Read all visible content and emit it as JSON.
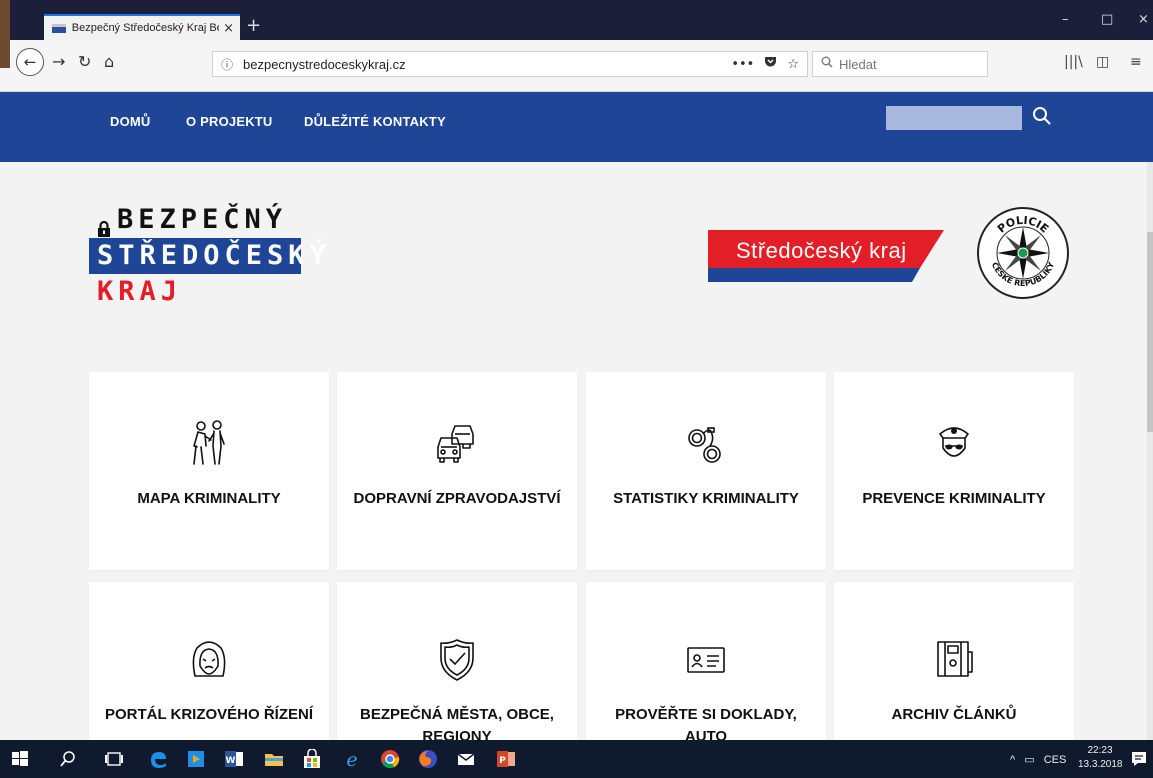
{
  "browser": {
    "tab_title": "Bezpečný Středočeský Kraj Bezp",
    "tab_close": "×",
    "new_tab": "+",
    "min": "–",
    "max": "□",
    "close": "×",
    "url": "bezpecnystredoceskykraj.cz",
    "url_info": "ⓘ",
    "page_actions": "•••",
    "search_placeholder": "Hledat"
  },
  "site": {
    "menu": [
      "DOMŮ",
      "O PROJEKTU",
      "DŮLEŽITÉ KONTAKTY"
    ],
    "logo": [
      "BEZPEČNÝ",
      "STŘEDOČESKÝ",
      "KRAJ"
    ],
    "kraj_banner": "Středočeský kraj",
    "seal_text": [
      "POLICIE",
      "ČESKÉ REPUBLIKY"
    ],
    "tiles": [
      {
        "label": "MAPA KRIMINALITY",
        "icon": "people-walking-icon"
      },
      {
        "label": "DOPRAVNÍ ZPRAVODAJSTVÍ",
        "icon": "cars-icon"
      },
      {
        "label": "STATISTIKY KRIMINALITY",
        "icon": "handcuffs-icon"
      },
      {
        "label": "PREVENCE KRIMINALITY",
        "icon": "police-officer-icon"
      },
      {
        "label": "PORTÁL KRIZOVÉHO ŘÍZENÍ",
        "icon": "distressed-face-icon"
      },
      {
        "label": "BEZPEČNÁ MĚSTA, OBCE, REGIONY",
        "icon": "shield-check-icon"
      },
      {
        "label": "PROVĚŘTE SI DOKLADY, AUTO",
        "icon": "id-card-icon"
      },
      {
        "label": "ARCHIV ČLÁNKŮ",
        "icon": "archive-binder-icon"
      }
    ]
  },
  "taskbar": {
    "tray_lang": "CES",
    "time": "22:23",
    "date": "13.3.2018"
  },
  "colors": {
    "header_blue": "#1e4596",
    "accent_red": "#e41e26",
    "content_bg": "#f3f3f3"
  }
}
